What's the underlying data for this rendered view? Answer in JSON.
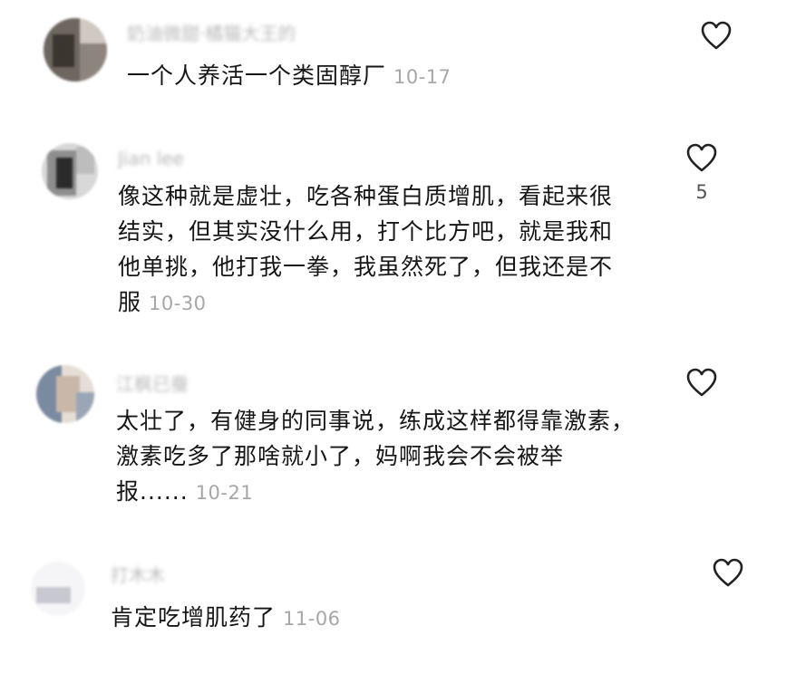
{
  "comments": [
    {
      "username": "奶油微甜·橘猫大王的",
      "text": "一个人养活一个类固醇厂",
      "date": "10-17",
      "likes": "",
      "avatar_colors": [
        "#3b3530",
        "#6e6760",
        "#cfc9c2"
      ]
    },
    {
      "username": "Jian lee",
      "text": "像这种就是虚壮，吃各种蛋白质增肌，看起来很结实，但其实没什么用，打个比方吧，就是我和他单挑，他打我一拳，我虽然死了，但我还是不服",
      "date": "10-30",
      "likes": "5",
      "avatar_colors": [
        "#2b2b2b",
        "#8e8e8e",
        "#d8d8d8"
      ]
    },
    {
      "username": "江枫已蚕",
      "text": "太壮了，有健身的同事说，练成这样都得靠激素，激素吃多了那啥就小了，妈啊我会不会被举报......",
      "date": "10-21",
      "likes": "",
      "avatar_colors": [
        "#7a8aa0",
        "#c9b8aa",
        "#e6ded6"
      ]
    },
    {
      "username": "打木木",
      "text": "肯定吃增肌药了",
      "date": "11-06",
      "likes": "",
      "avatar_colors": [
        "#c8c8d0",
        "#e8e8ec",
        "#f5f5f7"
      ]
    }
  ],
  "icons": {
    "like": "heart-outline-icon"
  }
}
